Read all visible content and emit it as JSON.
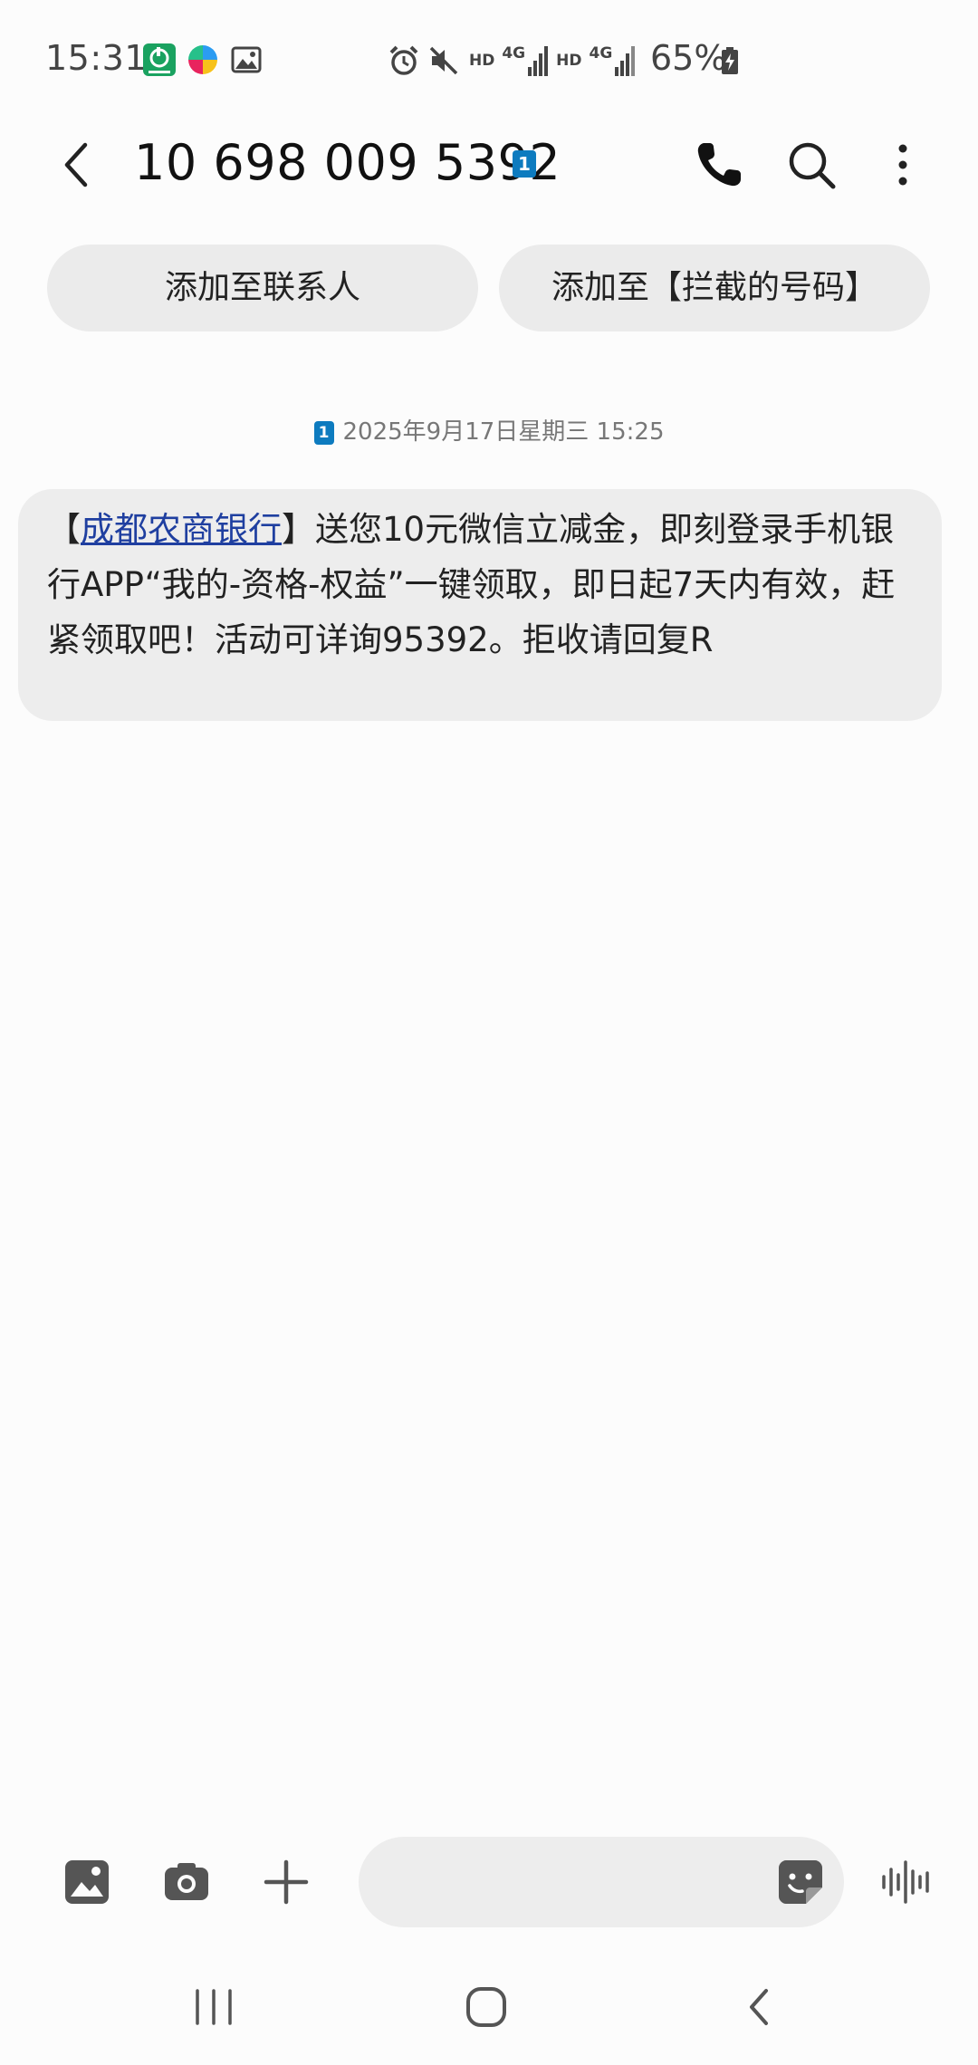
{
  "status_bar": {
    "time": "15:31",
    "hd_1": "HD",
    "net_1": "4G",
    "hd_2": "HD",
    "net_2": "4G",
    "battery": "65%"
  },
  "header": {
    "title": "10 698 009 5392",
    "sim_label": "1"
  },
  "actions": {
    "add_contact": "添加至联系人",
    "add_block": "添加至【拦截的号码】"
  },
  "conversation": {
    "date_sim": "1",
    "date": "2025年9月17日星期三 15:25",
    "message": {
      "prefix": "【",
      "link": "成都农商银行",
      "body": "】送您10元微信立减金，即刻登录手机银行APP“我的-资格-权益”一键领取，即日起7天内有效，赶紧领取吧！活动可详询95392。拒收请回复R"
    }
  },
  "compose": {
    "placeholder": "",
    "value": ""
  },
  "colors": {
    "background": "#fcfcfc",
    "chip": "#ebebeb",
    "bubble": "#ededed",
    "link": "#1f3fa0",
    "sim_badge": "#0d7bbf"
  },
  "icons": {
    "back": "back-arrow-icon",
    "call": "phone-icon",
    "search": "search-icon",
    "more": "more-vertical-icon",
    "gallery": "gallery-icon",
    "camera": "camera-icon",
    "plus": "plus-icon",
    "sticker": "sticker-icon",
    "voice": "voice-wave-icon"
  }
}
